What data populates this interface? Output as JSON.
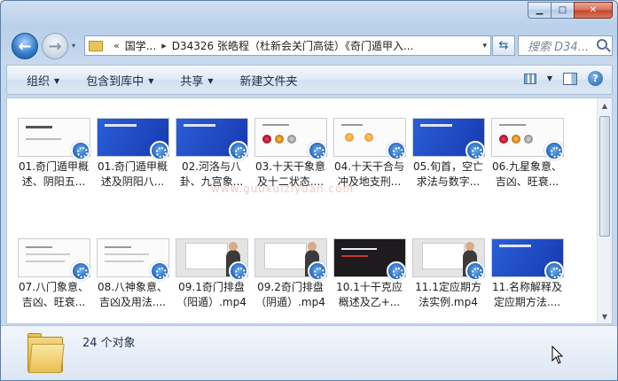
{
  "window": {
    "caption_buttons": {
      "minimize": "▁",
      "maximize": "□",
      "close": "✕"
    }
  },
  "nav": {
    "back_icon": "arrow-left-icon",
    "forward_icon": "arrow-right-icon",
    "history_drop": "▾"
  },
  "address": {
    "sep1": "«",
    "crumb1": "国学...",
    "sep2": "▸",
    "crumb2": "D34326 张皓程（杜新会关门高徒）《奇门遁甲入...",
    "drop": "▾",
    "refresh_glyph": "⇆"
  },
  "search": {
    "placeholder": "搜索 D34..."
  },
  "toolbar": {
    "organize": "组织",
    "include": "包含到库中",
    "share": "共享",
    "new_folder": "新建文件夹",
    "help": "?"
  },
  "files": [
    {
      "line1": "01.奇门遁甲概",
      "line2": "述、阴阳五...",
      "thumb": "white-title"
    },
    {
      "line1": "01.奇门遁甲概",
      "line2": "述及阴阳八...",
      "thumb": "blue"
    },
    {
      "line1": "02.河洛与八",
      "line2": "卦、九宫象...",
      "thumb": "blue"
    },
    {
      "line1": "03.十天干象意",
      "line2": "及十二状态....",
      "thumb": "white-photos"
    },
    {
      "line1": "04.十天干合与",
      "line2": "冲及地支刑...",
      "thumb": "white-sun"
    },
    {
      "line1": "05.旬首，空亡",
      "line2": "求法与数字...",
      "thumb": "blue"
    },
    {
      "line1": "06.九星象意、",
      "line2": "吉凶、旺衰...",
      "thumb": "white-photos"
    },
    {
      "line1": "07.八门象意、",
      "line2": "吉凶、旺衰...",
      "thumb": "white"
    },
    {
      "line1": "08.八神象意、",
      "line2": "吉凶及用法....",
      "thumb": "white"
    },
    {
      "line1": "09.1奇门排盘",
      "line2": "（阳遁）.mp4",
      "thumb": "teacher"
    },
    {
      "line1": "09.2奇门排盘",
      "line2": "（阴遁）.mp4",
      "thumb": "teacher"
    },
    {
      "line1": "10.1十干克应",
      "line2": "概述及乙+...",
      "thumb": "dark"
    },
    {
      "line1": "11.1定应期方",
      "line2": "法实例.mp4",
      "thumb": "teacher"
    },
    {
      "line1": "11.名称解释及",
      "line2": "定应期方法....",
      "thumb": "blue"
    }
  ],
  "watermark": "www.guoxuiziyuan.com",
  "details": {
    "count": "24 个对象"
  }
}
